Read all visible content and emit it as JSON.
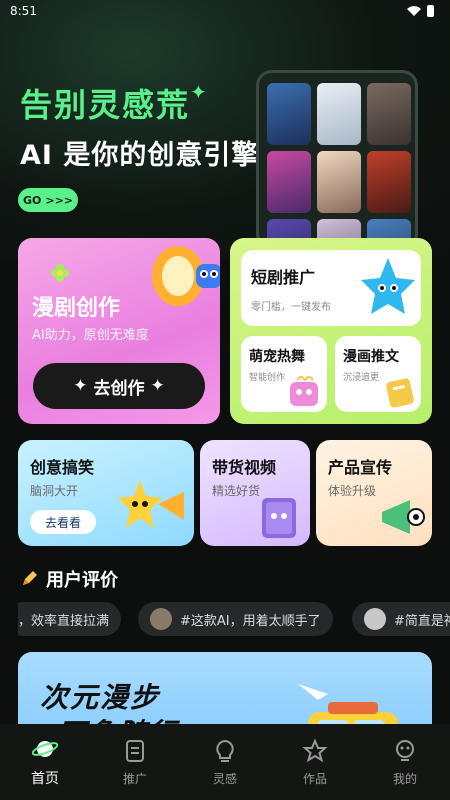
{
  "status": {
    "time": "8:51"
  },
  "hero": {
    "title": "告别灵感荒",
    "subtitle": "AI 是你的创意引擎",
    "go_label": "GO",
    "go_arrows": ">>>"
  },
  "create_card": {
    "title": "漫剧创作",
    "subtitle": "AI助力，原创无难度",
    "button_label": "去创作"
  },
  "right_card": {
    "top": {
      "title": "短剧推广",
      "subtitle": "零门槛，一键发布"
    },
    "left": {
      "title": "萌宠热舞",
      "subtitle": "智能创作"
    },
    "right": {
      "title": "漫画推文",
      "subtitle": "沉浸追更"
    }
  },
  "row_cards": [
    {
      "title": "创意搞笑",
      "subtitle": "脑洞大开",
      "button": "去看看"
    },
    {
      "title": "带货视频",
      "subtitle": "精选好货"
    },
    {
      "title": "产品宣传",
      "subtitle": "体验升级"
    }
  ],
  "reviews": {
    "heading": "用户评价",
    "chips": [
      "，效率直接拉满",
      "#这款AI，用着太顺手了",
      "#简直是神"
    ]
  },
  "banner": {
    "line1": "次元漫步",
    "line2": "万象随行"
  },
  "nav": {
    "items": [
      {
        "label": "首页",
        "icon": "planet-icon"
      },
      {
        "label": "推广",
        "icon": "document-icon"
      },
      {
        "label": "灵感",
        "icon": "lightbulb-icon"
      },
      {
        "label": "作品",
        "icon": "star-icon"
      },
      {
        "label": "我的",
        "icon": "profile-icon"
      }
    ]
  },
  "colors": {
    "accent": "#5af08a",
    "create_card": "#e97fe0",
    "right_card": "#b6f06a"
  }
}
